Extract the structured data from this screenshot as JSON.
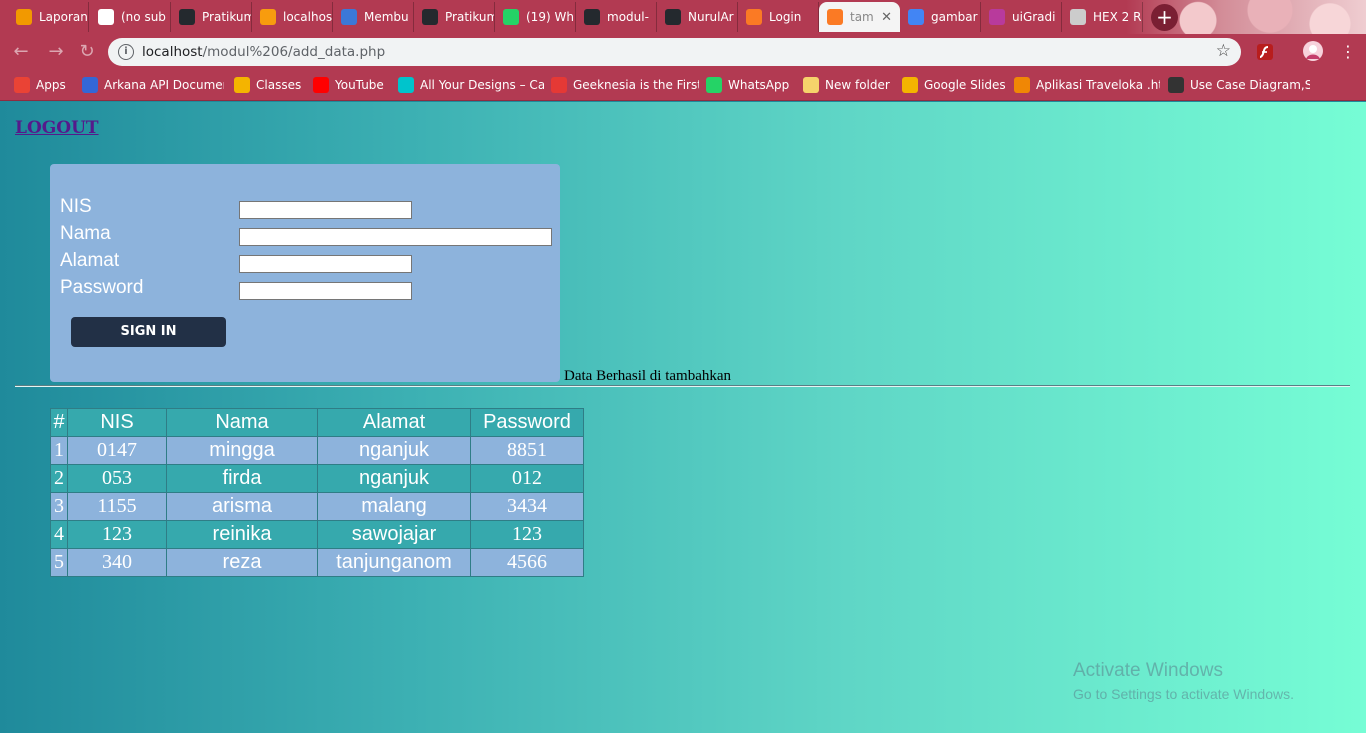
{
  "browser": {
    "tabs": [
      {
        "label": "Laporan",
        "favicon": "slides-icon",
        "color": "#f29900"
      },
      {
        "label": "(no sub",
        "favicon": "gmail-icon",
        "color": "#ffffff"
      },
      {
        "label": "Pratikum",
        "favicon": "github-icon",
        "color": "#24292e"
      },
      {
        "label": "localhost",
        "favicon": "phpmyadmin-icon",
        "color": "#f89c0e"
      },
      {
        "label": "Membu",
        "favicon": "bootstrap-icon",
        "color": "#3c78d8"
      },
      {
        "label": "Pratikum",
        "favicon": "github-icon",
        "color": "#24292e"
      },
      {
        "label": "(19) Wh",
        "favicon": "whatsapp-icon",
        "color": "#25d366"
      },
      {
        "label": "modul-",
        "favicon": "github-icon",
        "color": "#24292e"
      },
      {
        "label": "NurulAr",
        "favicon": "github-icon",
        "color": "#24292e"
      },
      {
        "label": "Login",
        "favicon": "xampp-icon",
        "color": "#fb7a24"
      },
      {
        "label": "tam",
        "favicon": "xampp-icon",
        "color": "#fb7a24",
        "active": true
      },
      {
        "label": "gambar",
        "favicon": "google-icon",
        "color": "#4285f4"
      },
      {
        "label": "uiGradi",
        "favicon": "uigradients-icon",
        "color": "#b83a9c"
      },
      {
        "label": "HEX 2 R",
        "favicon": "page-icon",
        "color": "#cccccc"
      }
    ],
    "url": "localhost/modul%206/add_data.php",
    "url_host": "localhost",
    "url_path": "/modul%206/add_data.php"
  },
  "bookmarks": [
    {
      "label": "Apps",
      "icon": "apps-grid-icon",
      "color": "#ea4335"
    },
    {
      "label": "Arkana API Documen",
      "icon": "bird-icon",
      "color": "#3367d6"
    },
    {
      "label": "Classes",
      "icon": "classroom-icon",
      "color": "#f4b400"
    },
    {
      "label": "YouTube",
      "icon": "youtube-icon",
      "color": "#ff0000"
    },
    {
      "label": "All Your Designs – Ca",
      "icon": "canva-icon",
      "color": "#00c4cc"
    },
    {
      "label": "Geeknesia is the First",
      "icon": "geeknesia-icon",
      "color": "#e53935"
    },
    {
      "label": "WhatsApp",
      "icon": "whatsapp-icon",
      "color": "#25d366"
    },
    {
      "label": "New folder",
      "icon": "folder-icon",
      "color": "#f6d36b"
    },
    {
      "label": "Google Slides",
      "icon": "slides-icon",
      "color": "#f4b400"
    },
    {
      "label": "Aplikasi Traveloka .ht",
      "icon": "drawio-icon",
      "color": "#f08705"
    },
    {
      "label": "Use Case Diagram,Sk",
      "icon": "diagram-icon",
      "color": "#333333"
    }
  ],
  "page": {
    "logout": "LOGOUT",
    "form": {
      "fields": [
        {
          "label": "NIS",
          "value": ""
        },
        {
          "label": "Nama",
          "value": ""
        },
        {
          "label": "Alamat",
          "value": ""
        },
        {
          "label": "Password",
          "value": ""
        }
      ],
      "submit": "SIGN IN"
    },
    "message": "Data Berhasil di tambahkan",
    "table": {
      "headers": [
        "#",
        "NIS",
        "Nama",
        "Alamat",
        "Password"
      ],
      "rows": [
        [
          "1",
          "0147",
          "mingga",
          "nganjuk",
          "8851"
        ],
        [
          "2",
          "053",
          "firda",
          "nganjuk",
          "012"
        ],
        [
          "3",
          "1155",
          "arisma",
          "malang",
          "3434"
        ],
        [
          "4",
          "123",
          "reinika",
          "sawojajar",
          "123"
        ],
        [
          "5",
          "340",
          "reza",
          "tanjunganom",
          "4566"
        ]
      ]
    }
  },
  "watermark": {
    "line1": "Activate Windows",
    "line2": "Go to Settings to activate Windows."
  }
}
